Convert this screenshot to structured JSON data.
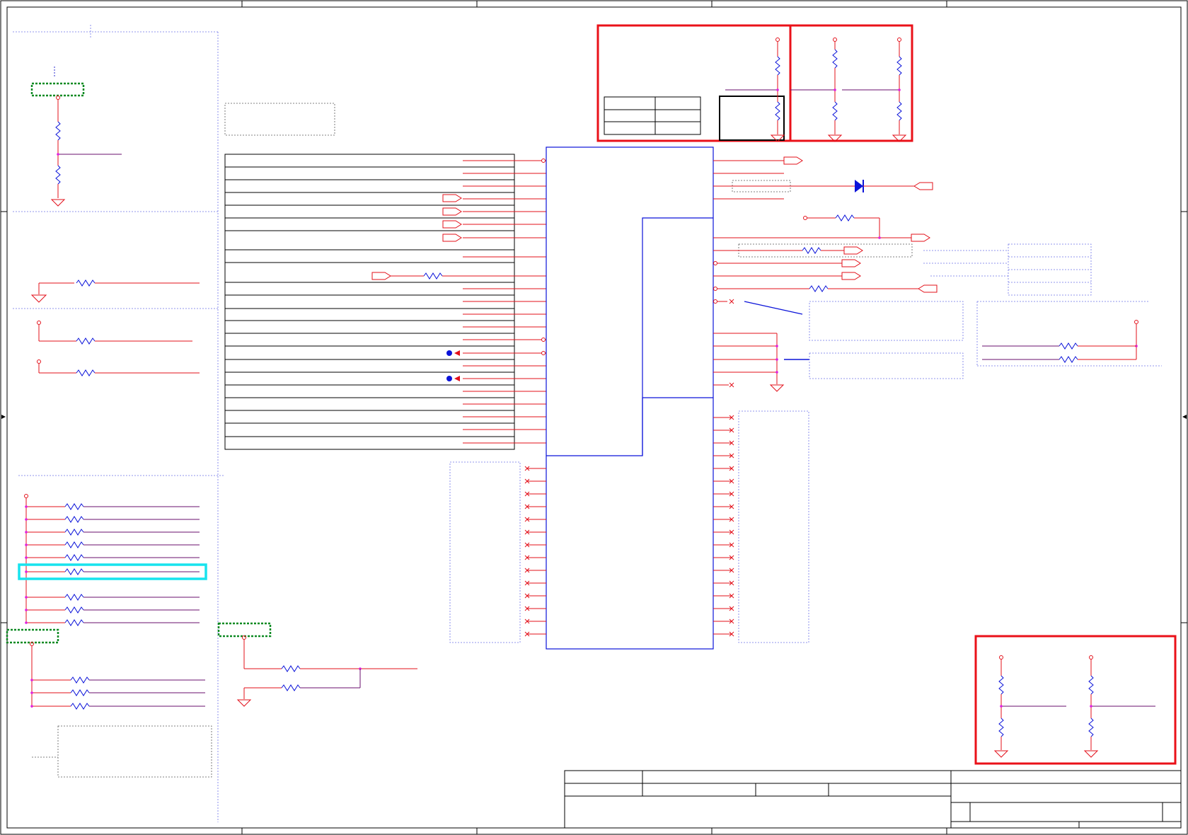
{
  "colors": {
    "wire": "#e3101a",
    "component": "#0b13d9",
    "net": "#6a0f6e",
    "grid": "#6f74e8",
    "highlight_red": "#ea1119",
    "highlight_cyan": "#17e3ee",
    "highlight_green": "#0d8a22",
    "junction": "#e020e0"
  },
  "icons": [
    "resistor-icon",
    "ground-icon",
    "power-port-icon",
    "diode-icon",
    "off-page-connector-icon",
    "no-connect-icon"
  ]
}
